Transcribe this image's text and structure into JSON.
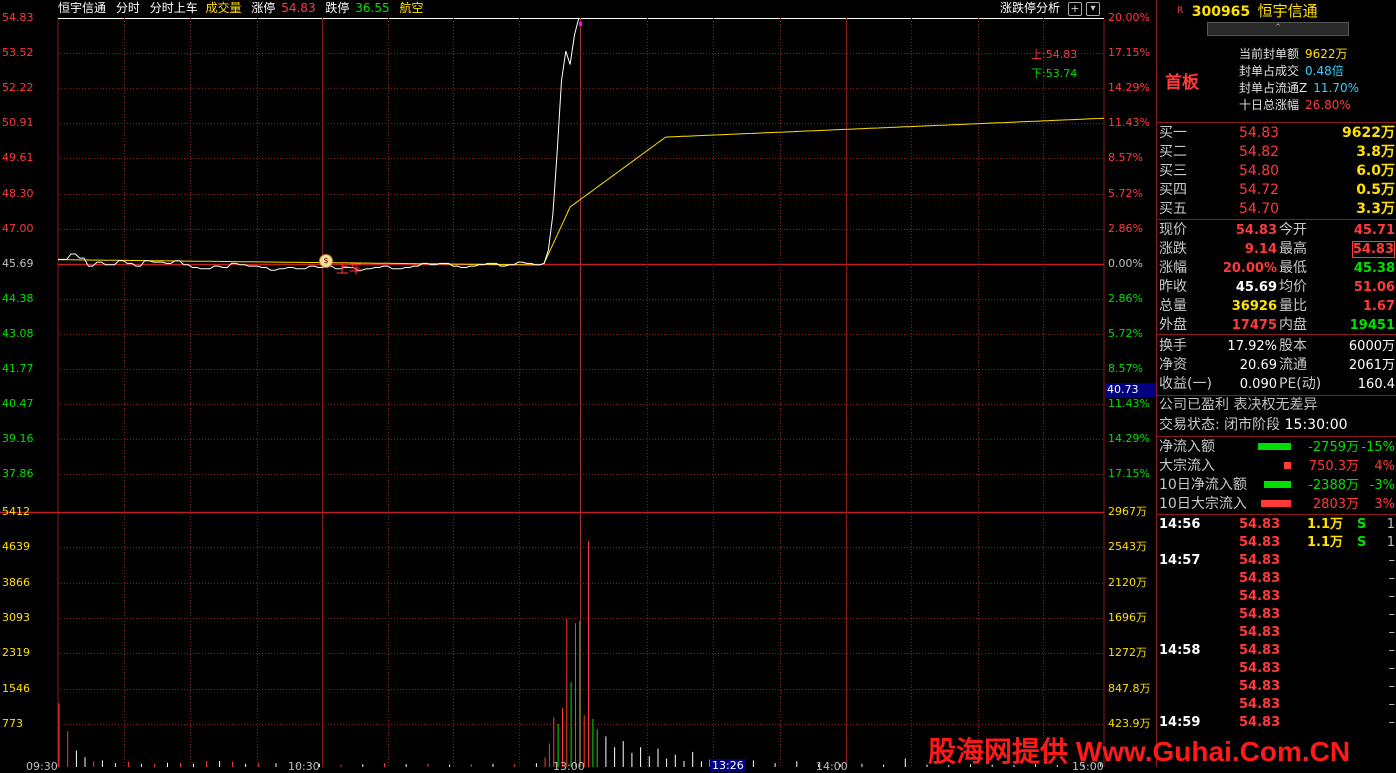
{
  "header": {
    "stock_name": "恒宇信通",
    "mode1": "分时",
    "mode2": "分时上车",
    "mode3": "成交量",
    "limit_up_label": "涨停",
    "limit_up_value": "54.83",
    "limit_down_label": "跌停",
    "limit_down_value": "36.55",
    "sector": "航空",
    "analysis_button": "涨跌停分析"
  },
  "price_axis_left": [
    "54.83",
    "53.52",
    "52.22",
    "50.91",
    "49.61",
    "48.30",
    "47.00",
    "45.69",
    "44.38",
    "43.08",
    "41.77",
    "40.47",
    "39.16",
    "37.86"
  ],
  "price_axis_right": [
    "20.00%",
    "17.15%",
    "14.29%",
    "11.43%",
    "8.57%",
    "5.72%",
    "2.86%",
    "0.00%",
    "2.86%",
    "5.72%",
    "8.57%",
    "11.43%",
    "14.29%",
    "17.15%"
  ],
  "volume_axis_left": [
    "5412",
    "4639",
    "3866",
    "3093",
    "2319",
    "1546",
    "773"
  ],
  "volume_axis_right": [
    "2967万",
    "2543万",
    "2120万",
    "1696万",
    "1272万",
    "847.8万",
    "423.9万"
  ],
  "chart_annotations": {
    "upper_label": "上:54.83",
    "lower_label": "下:53.74",
    "cursor_value": "40.73",
    "signal_text": "上车",
    "signal_icon": "money-bag-icon",
    "time_cursor": "13:26"
  },
  "time_axis": [
    "09:30",
    "10:30",
    "13:00",
    "14:00",
    "15:00"
  ],
  "colors": {
    "up": "#ff3a3a",
    "down": "#00e000",
    "grid": "#8b1a1a",
    "price_line": "#ffffff",
    "avg_line": "#ffe000"
  },
  "panel": {
    "badge": "R",
    "code": "300965",
    "name": "恒宇信通",
    "board_label": "首板",
    "seal": [
      {
        "label": "当前封单额",
        "value": "9622万"
      },
      {
        "label": "封单占成交",
        "value": "0.48倍"
      },
      {
        "label": "封单占流通Z",
        "value": "11.70%"
      },
      {
        "label": "十日总涨幅",
        "value": "26.80%"
      }
    ],
    "bids": [
      {
        "label": "买一",
        "price": "54.83",
        "vol": "9622万"
      },
      {
        "label": "买二",
        "price": "54.82",
        "vol": "3.8万"
      },
      {
        "label": "买三",
        "price": "54.80",
        "vol": "6.0万"
      },
      {
        "label": "买四",
        "price": "54.72",
        "vol": "0.5万"
      },
      {
        "label": "买五",
        "price": "54.70",
        "vol": "3.3万"
      }
    ],
    "quotes": [
      {
        "l1": "现价",
        "v1": "54.83",
        "l2": "今开",
        "v2": "45.71"
      },
      {
        "l1": "涨跌",
        "v1": "9.14",
        "l2": "最高",
        "v2": "54.83"
      },
      {
        "l1": "涨幅",
        "v1": "20.00%",
        "l2": "最低",
        "v2": "45.38"
      },
      {
        "l1": "昨收",
        "v1": "45.69",
        "l2": "均价",
        "v2": "51.06"
      },
      {
        "l1": "总量",
        "v1": "36926",
        "l2": "量比",
        "v2": "1.67"
      },
      {
        "l1": "外盘",
        "v1": "17475",
        "l2": "内盘",
        "v2": "19451"
      }
    ],
    "fundamentals": [
      {
        "l1": "换手",
        "v1": "17.92%",
        "l2": "股本",
        "v2": "6000万"
      },
      {
        "l1": "净资",
        "v1": "20.69",
        "l2": "流通",
        "v2": "2061万"
      },
      {
        "l1": "收益(一)",
        "v1": "0.090",
        "l2": "PE(动)",
        "v2": "160.4"
      }
    ],
    "notice": "公司已盈利 表决权无差异",
    "status_label": "交易状态:",
    "status_value": "闭市阶段",
    "status_time": "15:30:00",
    "flows": [
      {
        "label": "净流入额",
        "value": "-2759万",
        "pct": "-15%",
        "bar": 0.55,
        "color": "green"
      },
      {
        "label": "大宗流入",
        "value": "750.3万",
        "pct": "4%",
        "bar": 0.12,
        "color": "red"
      },
      {
        "label": "10日净流入额",
        "value": "-2388万",
        "pct": "-3%",
        "bar": 0.45,
        "color": "green"
      },
      {
        "label": "10日大宗流入",
        "value": "2803万",
        "pct": "3%",
        "bar": 0.5,
        "color": "red"
      }
    ],
    "ticks": [
      {
        "time": "14:56",
        "price": "54.83",
        "vol": "1.1万",
        "side": "S",
        "n": "1"
      },
      {
        "time": "",
        "price": "54.83",
        "vol": "1.1万",
        "side": "S",
        "n": "1"
      },
      {
        "time": "14:57",
        "price": "54.83",
        "vol": "",
        "side": "",
        "n": "–"
      },
      {
        "time": "",
        "price": "54.83",
        "vol": "",
        "side": "",
        "n": "–"
      },
      {
        "time": "",
        "price": "54.83",
        "vol": "",
        "side": "",
        "n": "–"
      },
      {
        "time": "",
        "price": "54.83",
        "vol": "",
        "side": "",
        "n": "–"
      },
      {
        "time": "",
        "price": "54.83",
        "vol": "",
        "side": "",
        "n": "–"
      },
      {
        "time": "14:58",
        "price": "54.83",
        "vol": "",
        "side": "",
        "n": "–"
      },
      {
        "time": "",
        "price": "54.83",
        "vol": "",
        "side": "",
        "n": "–"
      },
      {
        "time": "",
        "price": "54.83",
        "vol": "",
        "side": "",
        "n": "–"
      },
      {
        "time": "",
        "price": "54.83",
        "vol": "",
        "side": "",
        "n": "–"
      },
      {
        "time": "14:59",
        "price": "54.83",
        "vol": "",
        "side": "",
        "n": "–"
      }
    ]
  },
  "watermark": "股海网提供 Www.Guhai.Com.CN"
}
